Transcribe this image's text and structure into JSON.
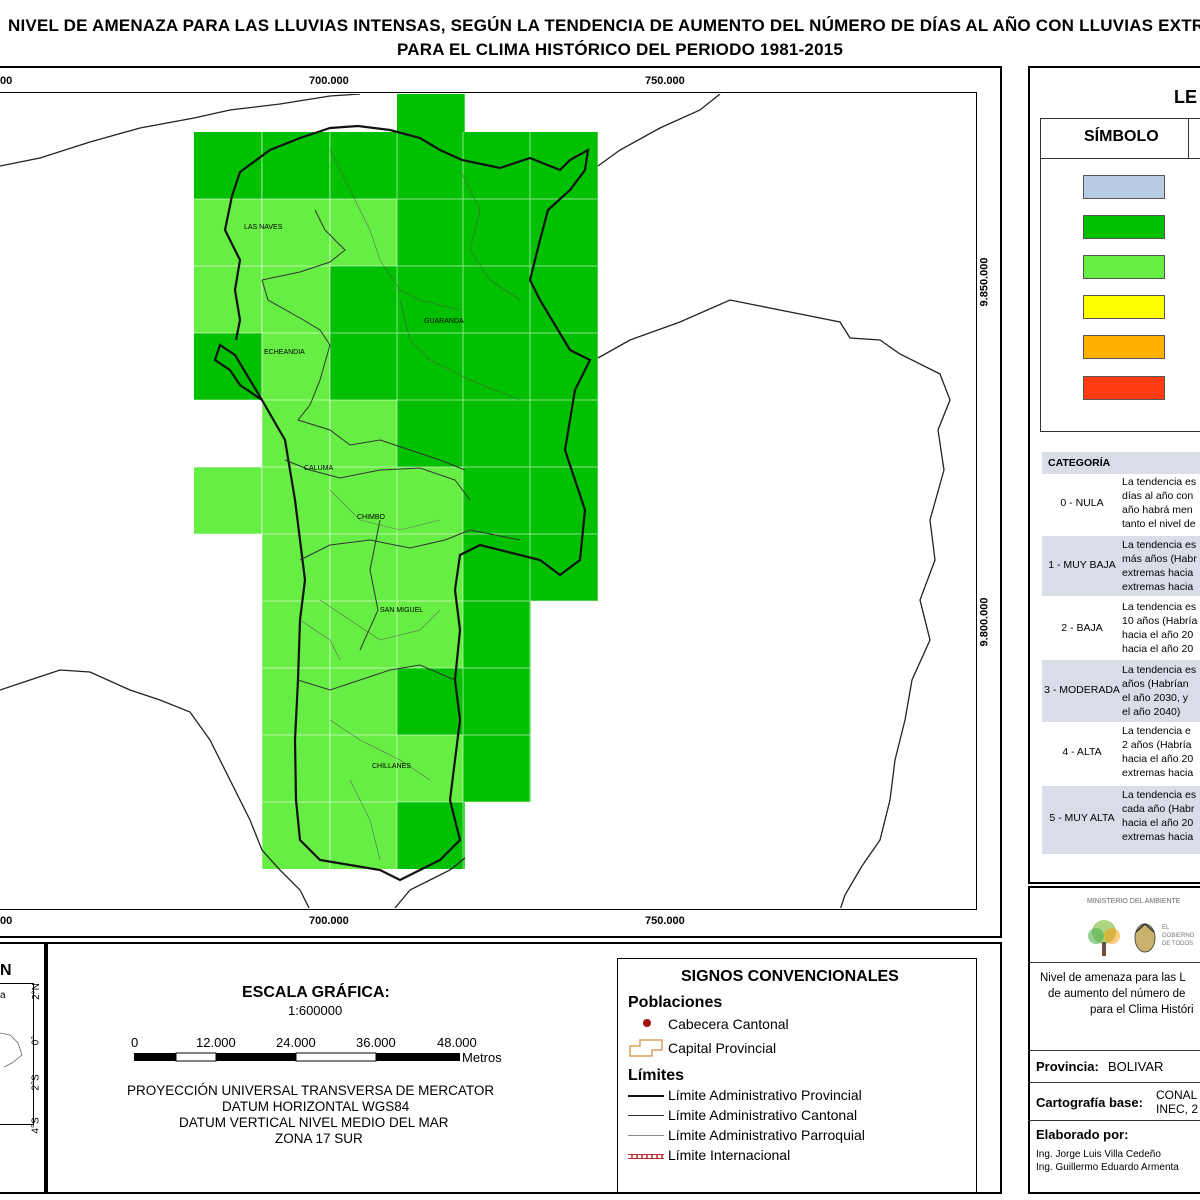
{
  "title": {
    "line1": "NIVEL DE AMENAZA PARA LAS LLUVIAS INTENSAS, SEGÚN LA TENDENCIA DE AUMENTO DEL NÚMERO DE DÍAS AL AÑO CON LLUVIAS EXTREMAS,",
    "line2": "PARA EL CLIMA HISTÓRICO DEL PERIODO 1981-2015"
  },
  "map": {
    "x_ticks": [
      "700.000",
      "750.000"
    ],
    "x_tick_left_partial": "00",
    "y_ticks": [
      "9.850.000",
      "9.800.000"
    ],
    "places": [
      "LAS NAVES",
      "GUARANDA",
      "ECHEANDIA",
      "CALUMA",
      "CHIMBO",
      "SAN MIGUEL",
      "CHILLANES"
    ],
    "grid_colors": {
      "level1": "#00c000",
      "level2": "#66ee44"
    }
  },
  "legend": {
    "title_partial": "LE",
    "symbol_header": "SÍMBOLO",
    "swatches": [
      "#b8cce4",
      "#00c000",
      "#66ee44",
      "#ffff00",
      "#ffb000",
      "#ff3b10"
    ],
    "category_header": "CATEGORÍA",
    "categories": [
      {
        "name": "0 - NULA",
        "desc": [
          "La tendencia es",
          "días al año con",
          "año habrá men",
          "tanto el nivel de"
        ]
      },
      {
        "name": "1 - MUY BAJA",
        "desc": [
          "La tendencia es",
          "más años (Habr",
          "extremas hacia",
          "extremas hacia"
        ]
      },
      {
        "name": "2 - BAJA",
        "desc": [
          "La tendencia es",
          "10 años (Habría",
          "hacia el año 20",
          "hacia el año 20"
        ]
      },
      {
        "name": "3 - MODERADA",
        "desc": [
          "La tendencia es",
          "años (Habrían",
          "el año 2030, y",
          "el año 2040)"
        ]
      },
      {
        "name": "4 - ALTA",
        "desc": [
          "La tendencia e",
          "2 años (Habría",
          "hacia el año 20",
          "extremas hacia"
        ]
      },
      {
        "name": "5 - MUY ALTA",
        "desc": [
          "La tendencia es",
          "cada año (Habr",
          "hacia el año 20",
          "extremas hacia"
        ]
      }
    ]
  },
  "inset": {
    "title_partial": "N",
    "lat_labels": [
      "2°N",
      "0°",
      "2°S",
      "4°S"
    ],
    "country_partial": "a"
  },
  "scale": {
    "title": "ESCALA GRÁFICA:",
    "ratio": "1:600000",
    "ticks": [
      "0",
      "12.000",
      "24.000",
      "36.000",
      "48.000"
    ],
    "unit": "Metros",
    "projection": [
      "PROYECCIÓN UNIVERSAL TRANSVERSA DE MERCATOR",
      "DATUM HORIZONTAL WGS84",
      "DATUM VERTICAL NIVEL MEDIO DEL MAR",
      "ZONA 17 SUR"
    ]
  },
  "signs": {
    "title": "SIGNOS CONVENCIONALES",
    "populations_head": "Poblaciones",
    "populations": [
      "Cabecera Cantonal",
      "Capital Provincial"
    ],
    "limits_head": "Límites",
    "limits": [
      "Límite Administrativo Provincial",
      "Límite Administrativo Cantonal",
      "Límite Administrativo Parroquial",
      "Límite Internacional"
    ]
  },
  "info": {
    "ministry": "MINISTERIO DEL AMBIENTE",
    "desc": [
      "Nivel de amenaza para las L",
      "de aumento del número de",
      "para el Clima Históri"
    ],
    "provincia_label": "Provincia:",
    "provincia_value": "BOLIVAR",
    "cartografia_label": "Cartografía base:",
    "cartografia_value": [
      "CONAL",
      "INEC, 2"
    ],
    "elaborado_label": "Elaborado por:",
    "authors": [
      "Ing. Jorge Luis Villa Cedeño",
      "Ing. Guillermo Eduardo Armenta"
    ],
    "logo_text": "EL GOBIERNO DE TODOS"
  }
}
